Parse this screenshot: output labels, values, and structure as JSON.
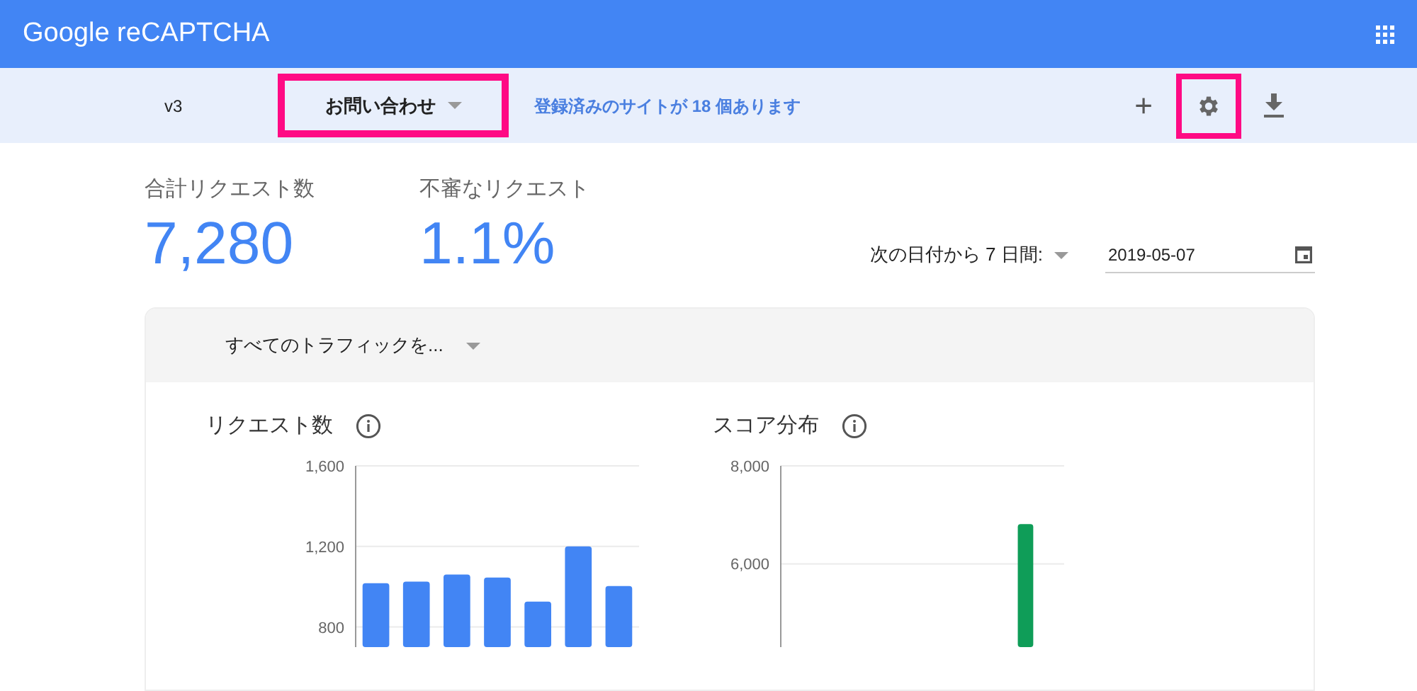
{
  "header": {
    "title": "Google reCAPTCHA"
  },
  "toolbar": {
    "version": "v3",
    "site_selector": {
      "label": "お問い合わせ",
      "highlighted": true
    },
    "sites_link": "登録済みのサイトが 18 個あります",
    "actions": [
      {
        "kind": "add",
        "label": "+",
        "highlighted": false
      },
      {
        "kind": "settings",
        "highlighted": true
      },
      {
        "kind": "download",
        "highlighted": false
      }
    ]
  },
  "stats": [
    {
      "label": "合計リクエスト数",
      "value": "7,280"
    },
    {
      "label": "不審なリクエスト",
      "value": "1.1%"
    }
  ],
  "date_range": {
    "label": "次の日付から 7 日間:",
    "date": "2019-05-07"
  },
  "traffic_filter": {
    "label": "すべてのトラフィックを..."
  },
  "charts": [
    {
      "title": "リクエスト数",
      "color": "#4285f4",
      "chart_data": {
        "type": "bar",
        "values": [
          1017,
          1025,
          1060,
          1045,
          926,
          1200,
          1003
        ],
        "ylim": [
          700,
          1600
        ],
        "yticks": [
          {
            "value": 800,
            "label": "800"
          },
          {
            "value": 1200,
            "label": "1,200"
          },
          {
            "value": 1600,
            "label": "1,600"
          }
        ]
      }
    },
    {
      "title": "スコア分布",
      "color": "#0f9d58",
      "chart_data": {
        "type": "bar",
        "values": [
          null,
          null,
          null,
          null,
          null,
          null,
          null,
          null,
          null,
          6810,
          null
        ],
        "ylim": [
          4300,
          8000
        ],
        "yticks": [
          {
            "value": 6000,
            "label": "6,000"
          },
          {
            "value": 8000,
            "label": "8,000"
          }
        ]
      }
    }
  ]
}
